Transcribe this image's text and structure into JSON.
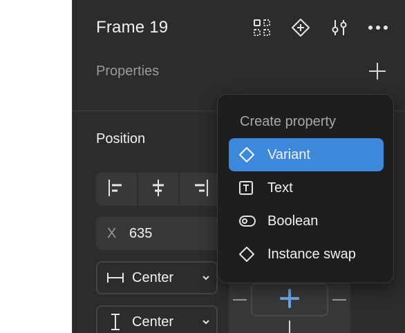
{
  "header": {
    "title": "Frame 19",
    "icons": [
      "component-grid-icon",
      "component-add-icon",
      "adjustments-icon",
      "more-icon"
    ]
  },
  "properties": {
    "label": "Properties",
    "add_icon": "plus-icon"
  },
  "position": {
    "title": "Position",
    "align_buttons": [
      "align-left-icon",
      "align-center-icon",
      "align-right-icon"
    ],
    "x_label": "X",
    "x_value": "635",
    "horizontal_constraint": "Center",
    "vertical_constraint": "Center"
  },
  "popover": {
    "title": "Create property",
    "items": [
      {
        "label": "Variant",
        "icon": "diamond-icon",
        "active": true
      },
      {
        "label": "Text",
        "icon": "text-box-icon",
        "active": false
      },
      {
        "label": "Boolean",
        "icon": "toggle-icon",
        "active": false
      },
      {
        "label": "Instance swap",
        "icon": "diamond-icon",
        "active": false
      }
    ]
  },
  "colors": {
    "panel_bg": "#2c2c2c",
    "popover_bg": "#1e1e1e",
    "accent": "#3e88dc",
    "constraint_plus": "#6aa7e8"
  }
}
